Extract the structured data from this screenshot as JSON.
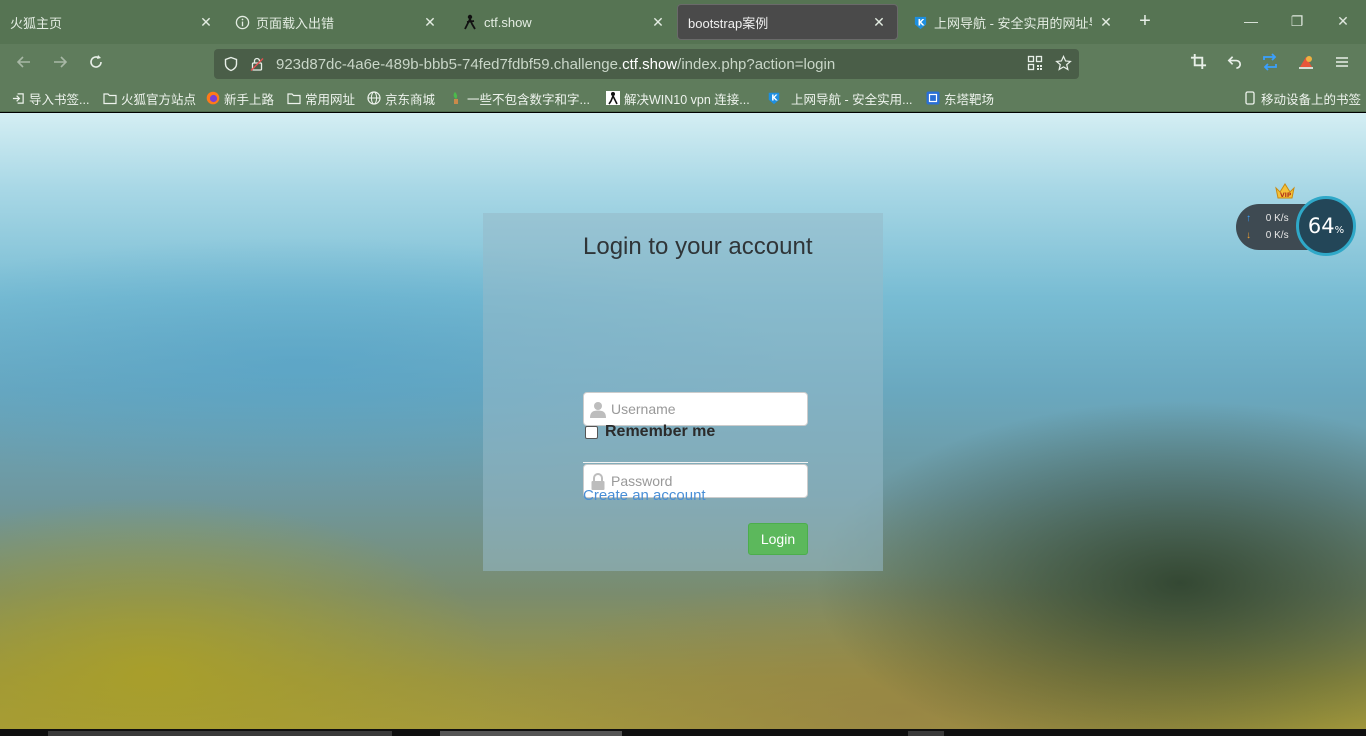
{
  "tabs": [
    {
      "label": "火狐主页",
      "icon": "none",
      "active": false
    },
    {
      "label": "页面载入出错",
      "icon": "info-icon",
      "active": false
    },
    {
      "label": "ctf.show",
      "icon": "ninja-icon",
      "active": false
    },
    {
      "label": "bootstrap案例",
      "icon": "none",
      "active": true
    },
    {
      "label": "上网导航 - 安全实用的网址导航",
      "icon": "k-nav-icon",
      "active": false
    }
  ],
  "tab_close_glyph": "✕",
  "new_tab_glyph": "+",
  "window_controls": {
    "minimize": "—",
    "restore": "❐",
    "close": "✕"
  },
  "address_bar": {
    "url_prefix": "923d87dc-4a6e-489b-bbb5-74fed7fdbf59.challenge.",
    "url_domain": "ctf.show",
    "url_suffix": "/index.php?action=login"
  },
  "bookmarks": [
    {
      "label": "导入书签...",
      "icon": "import-icon"
    },
    {
      "label": "火狐官方站点",
      "icon": "folder-icon"
    },
    {
      "label": "新手上路",
      "icon": "firefox-icon"
    },
    {
      "label": "常用网址",
      "icon": "folder-icon"
    },
    {
      "label": "京东商城",
      "icon": "globe-icon"
    },
    {
      "label": "一些不包含数字和字...",
      "icon": "plant-icon"
    },
    {
      "label": "解决WIN10 vpn 连接...",
      "icon": "figure-icon"
    },
    {
      "label": "上网导航 - 安全实用...",
      "icon": "k-nav-icon"
    },
    {
      "label": "东塔靶场",
      "icon": "target-icon"
    }
  ],
  "mobile_bookmarks": "移动设备上的书签",
  "login": {
    "title": "Login to your account",
    "username_placeholder": "Username",
    "password_placeholder": "Password",
    "remember_label": "Remember me",
    "create_account": "Create an account",
    "login_button": "Login"
  },
  "speed_widget": {
    "upload": "0 K/s",
    "download": "0 K/s",
    "percent": "64",
    "percent_sign": "%",
    "badge": "VIP"
  },
  "colors": {
    "chrome_green": "#567453",
    "nav_green": "#5f7c5c",
    "login_button": "#5cb85c",
    "link_blue": "#4a8fd6",
    "widget_ring": "#2fa8c8"
  }
}
